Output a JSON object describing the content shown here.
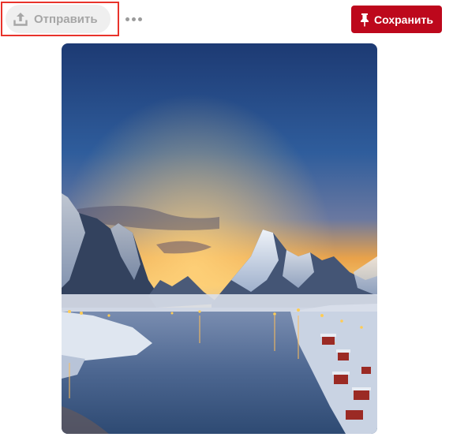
{
  "toolbar": {
    "share_label": "Отправить",
    "share_icon": "upload-icon",
    "more_icon": "more-dots-icon",
    "save_label": "Сохранить",
    "save_icon": "pushpin-icon"
  },
  "colors": {
    "save_button": "#bd081c",
    "share_button_bg": "#efefef",
    "highlight_border": "#e8332b"
  }
}
